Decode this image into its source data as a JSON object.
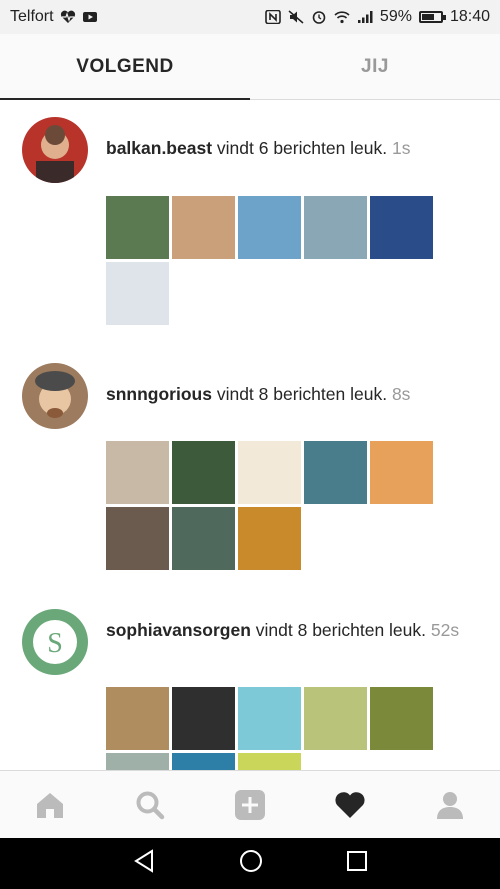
{
  "status_bar": {
    "carrier": "Telfort",
    "battery_percent": "59%",
    "battery_level": 0.59,
    "time": "18:40",
    "icons": [
      "heart-monitor-icon",
      "youtube-icon",
      "nfc-icon",
      "mute-icon",
      "alarm-icon",
      "wifi-icon",
      "signal-icon",
      "battery-icon"
    ]
  },
  "tabs": [
    {
      "label": "VOLGEND",
      "active": true
    },
    {
      "label": "JIJ",
      "active": false
    }
  ],
  "feed": [
    {
      "username": "balkan.beast",
      "action": " vindt 6 berichten leuk. ",
      "time": "1s",
      "thumbs": [
        "#5c7a52",
        "#c9a07a",
        "#6ea3c9",
        "#8aa7b5",
        "#2a4d8a",
        "#dfe3ea"
      ]
    },
    {
      "username": "snnngorious",
      "action": " vindt 8 berichten leuk. ",
      "time": "8s",
      "thumbs": [
        "#c8b9a6",
        "#3d5b3a",
        "#f2e9d8",
        "#4a7d8c",
        "#e7a15a",
        "#6b5a4e",
        "#4f6a5d",
        "#c98a2b"
      ]
    },
    {
      "username": "sophiavansorgen",
      "action": " vindt 8 berichten leuk. ",
      "time": "52s",
      "thumbs": [
        "#b08d5e",
        "#2f2f2f",
        "#7ec9d7",
        "#b9c47a",
        "#7b8a3a",
        "#9fb0a8",
        "#2e7fa8",
        "#c9d65a"
      ]
    }
  ],
  "bottom_nav": [
    "home-icon",
    "search-icon",
    "add-post-icon",
    "activity-heart-icon",
    "profile-icon"
  ],
  "android_nav": [
    "back-icon",
    "home-circle-icon",
    "recents-icon"
  ]
}
